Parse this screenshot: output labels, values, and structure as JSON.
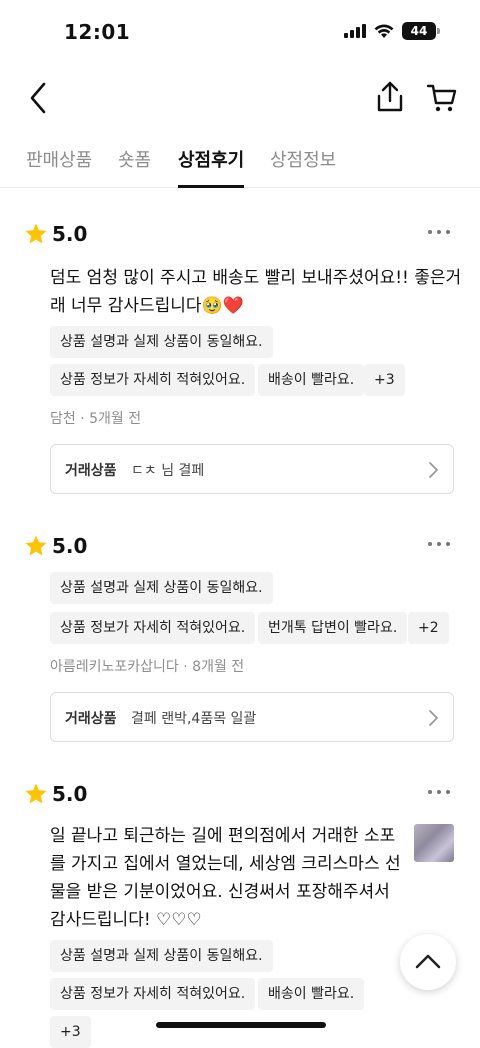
{
  "status_bar": {
    "time": "12:01",
    "battery": "44"
  },
  "nav": {
    "back_icon": "chevron-left-icon",
    "share_icon": "share-icon",
    "cart_icon": "cart-icon"
  },
  "tabs": [
    {
      "label": "판매상품",
      "active": false
    },
    {
      "label": "숏폼",
      "active": false
    },
    {
      "label": "상점후기",
      "active": true
    },
    {
      "label": "상점정보",
      "active": false
    }
  ],
  "reviews": [
    {
      "rating": "5.0",
      "content": [
        "덤도 엄청 많이 주시고 배송도 빨리 보내주셨어요!! 좋은거",
        "래 너무 감사드립니다🥹❤️"
      ],
      "tags": [
        "상품 설명과 실제 상품이 동일해요.",
        "상품 정보가 자세히 적혀있어요.",
        "배송이 빨라요.",
        "+3"
      ],
      "author": "담천",
      "time": "5개월 전",
      "product_label": "거래상품",
      "product_name": "ㄷㅊ 님 결페"
    },
    {
      "rating": "5.0",
      "tags": [
        "상품 설명과 실제 상품이 동일해요.",
        "상품 정보가 자세히 적혀있어요.",
        "번개톡 답변이 빨라요.",
        "+2"
      ],
      "author": "아름레키노포카삽니다",
      "time": "8개월 전",
      "product_label": "거래상품",
      "product_name": "결페 랜박,4품목 일괄"
    },
    {
      "rating": "5.0",
      "content": [
        "일 끝나고 퇴근하는 길에 편의점에서 거래한 소포",
        "를 가지고 집에서 열었는데, 세상엠 크리스마스 선",
        "물을 받은 기분이었어요. 신경써서 포장해주셔서",
        "감사드립니다! ♡♡♡"
      ],
      "tags": [
        "상품 설명과 실제 상품이 동일해요.",
        "상품 정보가 자세히 적혀있어요.",
        "배송이 빨라요.",
        "+3"
      ]
    }
  ],
  "colors": {
    "star": "#FFC400",
    "heart": "#E0262D",
    "tag_bg": "#F3F3F3",
    "muted": "#8E8E8E"
  }
}
